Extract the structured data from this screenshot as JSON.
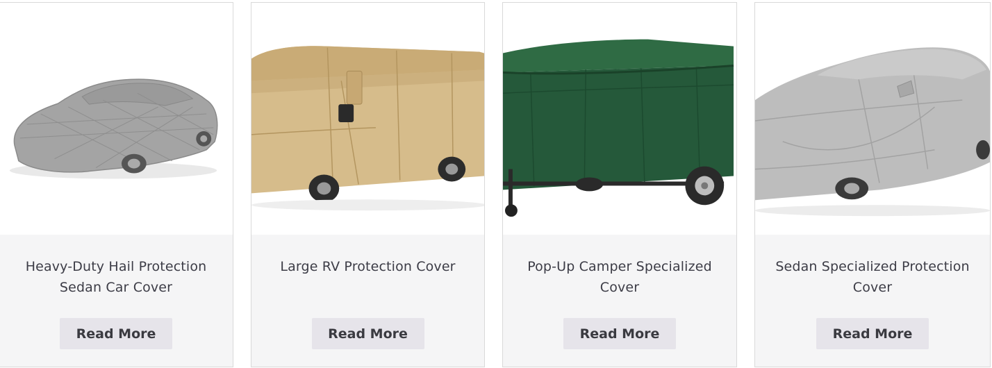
{
  "products": [
    {
      "title": "Heavy-Duty Hail Protection Sedan Car Cover",
      "image": "gray-quilted-sedan-car-cover",
      "button_label": "Read More",
      "cover_color": "#a6a6a6"
    },
    {
      "title": "Large RV Protection Cover",
      "image": "tan-rv-cover",
      "button_label": "Read More",
      "cover_color": "#d3b888"
    },
    {
      "title": "Pop-Up Camper Specialized Cover",
      "image": "green-pop-up-camper-cover",
      "button_label": "Read More",
      "cover_color": "#245c39"
    },
    {
      "title": "Sedan Specialized Protection Cover",
      "image": "light-gray-sedan-cover",
      "button_label": "Read More",
      "cover_color": "#bdbdbd"
    }
  ]
}
